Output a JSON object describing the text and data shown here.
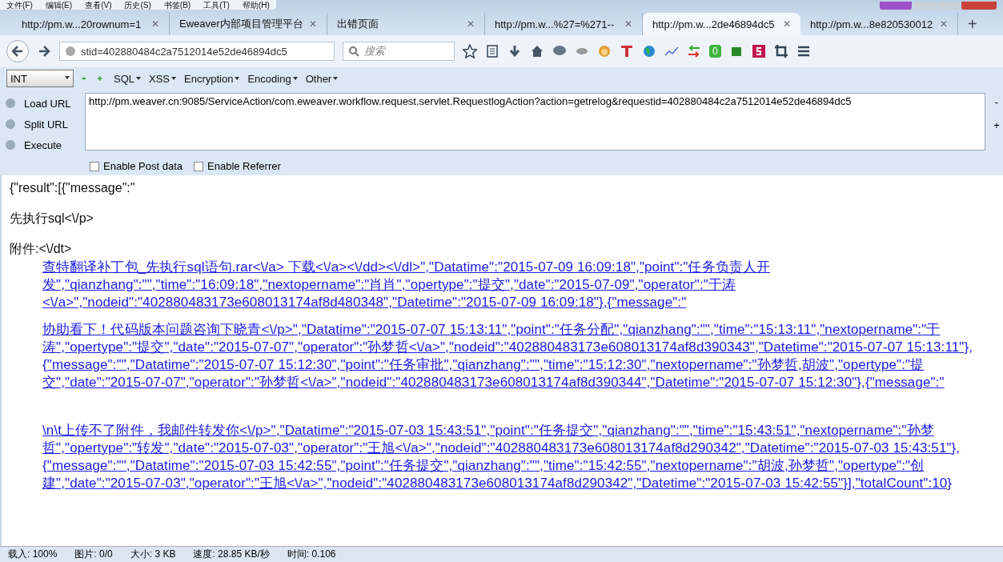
{
  "menu_bar": [
    "文件(F)",
    "编辑(E)",
    "查看(V)",
    "历史(S)",
    "书签(B)",
    "工具(T)",
    "帮助(H)"
  ],
  "tabs": [
    {
      "label": "http://pm.w...20rownum=1",
      "selected": false
    },
    {
      "label": "Eweaver内部项目管理平台",
      "selected": false
    },
    {
      "label": "出错页面",
      "selected": false
    },
    {
      "label": "http://pm.w...%27=%271--",
      "selected": false
    },
    {
      "label": "http://pm.w...2de46894dc5",
      "selected": true
    },
    {
      "label": "http://pm.w...8e820530012",
      "selected": false
    }
  ],
  "tab_close": "✕",
  "new_tab": "+",
  "address_bar": {
    "value": "stid=402880484c2a7512014e52de46894dc5"
  },
  "search": {
    "placeholder": "搜索"
  },
  "toolbar_badge": "0",
  "hackbar": {
    "select": "INT",
    "menus": [
      "SQL",
      "XSS",
      "Encryption",
      "Encoding",
      "Other"
    ],
    "actions": [
      "Load URL",
      "Split URL",
      "Execute"
    ],
    "url": "http://pm.weaver.cn:9085/ServiceAction/com.eweaver.workflow.request.servlet.RequestlogAction?action=getrelog&requestid=402880484c2a7512014e52de46894dc5",
    "side_buttons": [
      "-",
      "+"
    ],
    "options": [
      {
        "label": "Enable Post data",
        "checked": false
      },
      {
        "label": "Enable Referrer",
        "checked": false
      }
    ]
  },
  "content": {
    "lines": [
      "{\"result\":[{\"message\":\"",
      "先执行sql<\\/p>",
      "附件:<\\/dt>"
    ],
    "link_blocks": [
      [
        "查特翻译补丁包_先执行sql语句.rar<\\/a> 下载<\\/a><\\/dd><\\/dl>\",\"Datatime\":\"2015-07-09 16:09:18\",\"point\":\"任务负责人开",
        "发\",\"qianzhang\":\"\",\"time\":\"16:09:18\",\"nextopername\":\"肖肖\",\"opertype\":\"提交\",\"date\":\"2015-07-09\",\"operator\":\"于涛",
        "<\\/a>\",\"nodeid\":\"402880483173e608013174af8d480348\",\"Datetime\":\"2015-07-09 16:09:18\"},{\"message\":\""
      ],
      [
        "协助看下！代码版本问题咨询下晓青<\\/p>\",\"Datatime\":\"2015-07-07 15:13:11\",\"point\":\"任务分配\",\"qianzhang\":\"\",\"time\":\"15:13:11\",\"nextopername\":\"于",
        "涛\",\"opertype\":\"提交\",\"date\":\"2015-07-07\",\"operator\":\"孙梦哲<\\/a>\",\"nodeid\":\"402880483173e608013174af8d390343\",\"Datetime\":\"2015-07-07 15:13:11\"},",
        "{\"message\":\"\",\"Datatime\":\"2015-07-07 15:12:30\",\"point\":\"任务审批\",\"qianzhang\":\"\",\"time\":\"15:12:30\",\"nextopername\":\"孙梦哲,胡波\",\"opertype\":\"提",
        "交\",\"date\":\"2015-07-07\",\"operator\":\"孙梦哲<\\/a>\",\"nodeid\":\"402880483173e608013174af8d390344\",\"Datetime\":\"2015-07-07 15:12:30\"},{\"message\":\""
      ],
      [
        "\\n\\t上传不了附件，我邮件转发你<\\/p>\",\"Datatime\":\"2015-07-03 15:43:51\",\"point\":\"任务提交\",\"qianzhang\":\"\",\"time\":\"15:43:51\",\"nextopername\":\"孙梦",
        "哲\",\"opertype\":\"转发\",\"date\":\"2015-07-03\",\"operator\":\"王旭<\\/a>\",\"nodeid\":\"402880483173e608013174af8d290342\",\"Datetime\":\"2015-07-03 15:43:51\"},",
        "{\"message\":\"\",\"Datatime\":\"2015-07-03 15:42:55\",\"point\":\"任务提交\",\"qianzhang\":\"\",\"time\":\"15:42:55\",\"nextopername\":\"胡波,孙梦哲\",\"opertype\":\"创",
        "建\",\"date\":\"2015-07-03\",\"operator\":\"王旭<\\/a>\",\"nodeid\":\"402880483173e608013174af8d290342\",\"Datetime\":\"2015-07-03 15:42:55\"}],\"totalCount\":10}"
      ]
    ]
  },
  "status_bar": [
    "载入: 100%",
    "图片: 0/0",
    "大小: 3 KB",
    "速度: 28.85 KB/秒",
    "时间: 0.106"
  ]
}
